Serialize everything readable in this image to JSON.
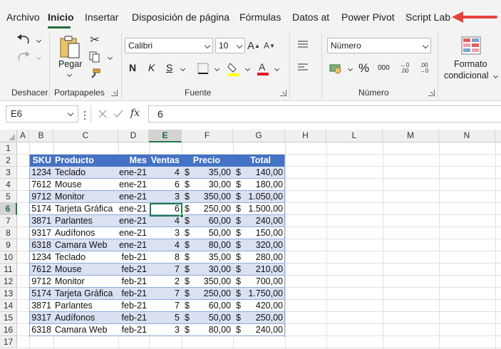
{
  "tabs": [
    {
      "label": "Archivo",
      "active": false
    },
    {
      "label": "Inicio",
      "active": true
    },
    {
      "label": "Insertar",
      "active": false
    },
    {
      "label": "Disposición de página",
      "active": false
    },
    {
      "label": "Fórmulas",
      "active": false
    },
    {
      "label": "Datos at",
      "active": false
    },
    {
      "label": "Power Pivot",
      "active": false
    },
    {
      "label": "Script Lab",
      "active": false
    }
  ],
  "annotation": {
    "arrow_color": "#e8413b"
  },
  "ribbon": {
    "undo_group": "Deshacer",
    "clipboard": {
      "paste": "Pegar",
      "group": "Portapapeles"
    },
    "font": {
      "name": "Calibri",
      "size": "10",
      "bold": "N",
      "italic": "K",
      "underline": "S",
      "group": "Fuente",
      "highlight_color": "#ffff00",
      "font_color": "#e81123"
    },
    "number": {
      "format": "Número",
      "percent": "%",
      "thousands": "000",
      "group": "Número"
    },
    "styles": {
      "cond_format_line1": "Formato",
      "cond_format_line2": "condicional"
    }
  },
  "formula_bar": {
    "name_box": "E6",
    "fx": "fx",
    "value": "6"
  },
  "columns": [
    "A",
    "B",
    "C",
    "D",
    "E",
    "F",
    "G",
    "H",
    "L",
    "M",
    "N"
  ],
  "selected_column": "E",
  "rows": [
    "1",
    "2",
    "3",
    "4",
    "5",
    "6",
    "7",
    "8",
    "9",
    "10",
    "11",
    "12",
    "13",
    "14",
    "15",
    "16",
    "17"
  ],
  "selected_row": "6",
  "table": {
    "headers": {
      "sku": "SKU",
      "producto": "Producto",
      "mes": "Mes",
      "ventas": "Ventas",
      "precio": "Precio",
      "total": "Total"
    },
    "header_color": "#4472c4",
    "band_color": "#d9e1f2",
    "rows": [
      {
        "sku": "1234",
        "producto": "Teclado",
        "mes": "ene-21",
        "ventas": "4",
        "precio": "35,00",
        "total": "140,00"
      },
      {
        "sku": "7612",
        "producto": "Mouse",
        "mes": "ene-21",
        "ventas": "6",
        "precio": "30,00",
        "total": "180,00"
      },
      {
        "sku": "9712",
        "producto": "Monitor",
        "mes": "ene-21",
        "ventas": "3",
        "precio": "350,00",
        "total": "1.050,00"
      },
      {
        "sku": "5174",
        "producto": "Tarjeta Gráfica",
        "mes": "ene-21",
        "ventas": "6",
        "precio": "250,00",
        "total": "1.500,00"
      },
      {
        "sku": "3871",
        "producto": "Parlantes",
        "mes": "ene-21",
        "ventas": "4",
        "precio": "60,00",
        "total": "240,00"
      },
      {
        "sku": "9317",
        "producto": "Audífonos",
        "mes": "ene-21",
        "ventas": "3",
        "precio": "50,00",
        "total": "150,00"
      },
      {
        "sku": "6318",
        "producto": "Camara Web",
        "mes": "ene-21",
        "ventas": "4",
        "precio": "80,00",
        "total": "320,00"
      },
      {
        "sku": "1234",
        "producto": "Teclado",
        "mes": "feb-21",
        "ventas": "8",
        "precio": "35,00",
        "total": "280,00"
      },
      {
        "sku": "7612",
        "producto": "Mouse",
        "mes": "feb-21",
        "ventas": "7",
        "precio": "30,00",
        "total": "210,00"
      },
      {
        "sku": "9712",
        "producto": "Monitor",
        "mes": "feb-21",
        "ventas": "2",
        "precio": "350,00",
        "total": "700,00"
      },
      {
        "sku": "5174",
        "producto": "Tarjeta Gráfica",
        "mes": "feb-21",
        "ventas": "7",
        "precio": "250,00",
        "total": "1.750,00"
      },
      {
        "sku": "3871",
        "producto": "Parlantes",
        "mes": "feb-21",
        "ventas": "7",
        "precio": "60,00",
        "total": "420,00"
      },
      {
        "sku": "9317",
        "producto": "Audífonos",
        "mes": "feb-21",
        "ventas": "5",
        "precio": "50,00",
        "total": "250,00"
      },
      {
        "sku": "6318",
        "producto": "Camara Web",
        "mes": "feb-21",
        "ventas": "3",
        "precio": "80,00",
        "total": "240,00"
      }
    ]
  },
  "currency_symbol": "$"
}
